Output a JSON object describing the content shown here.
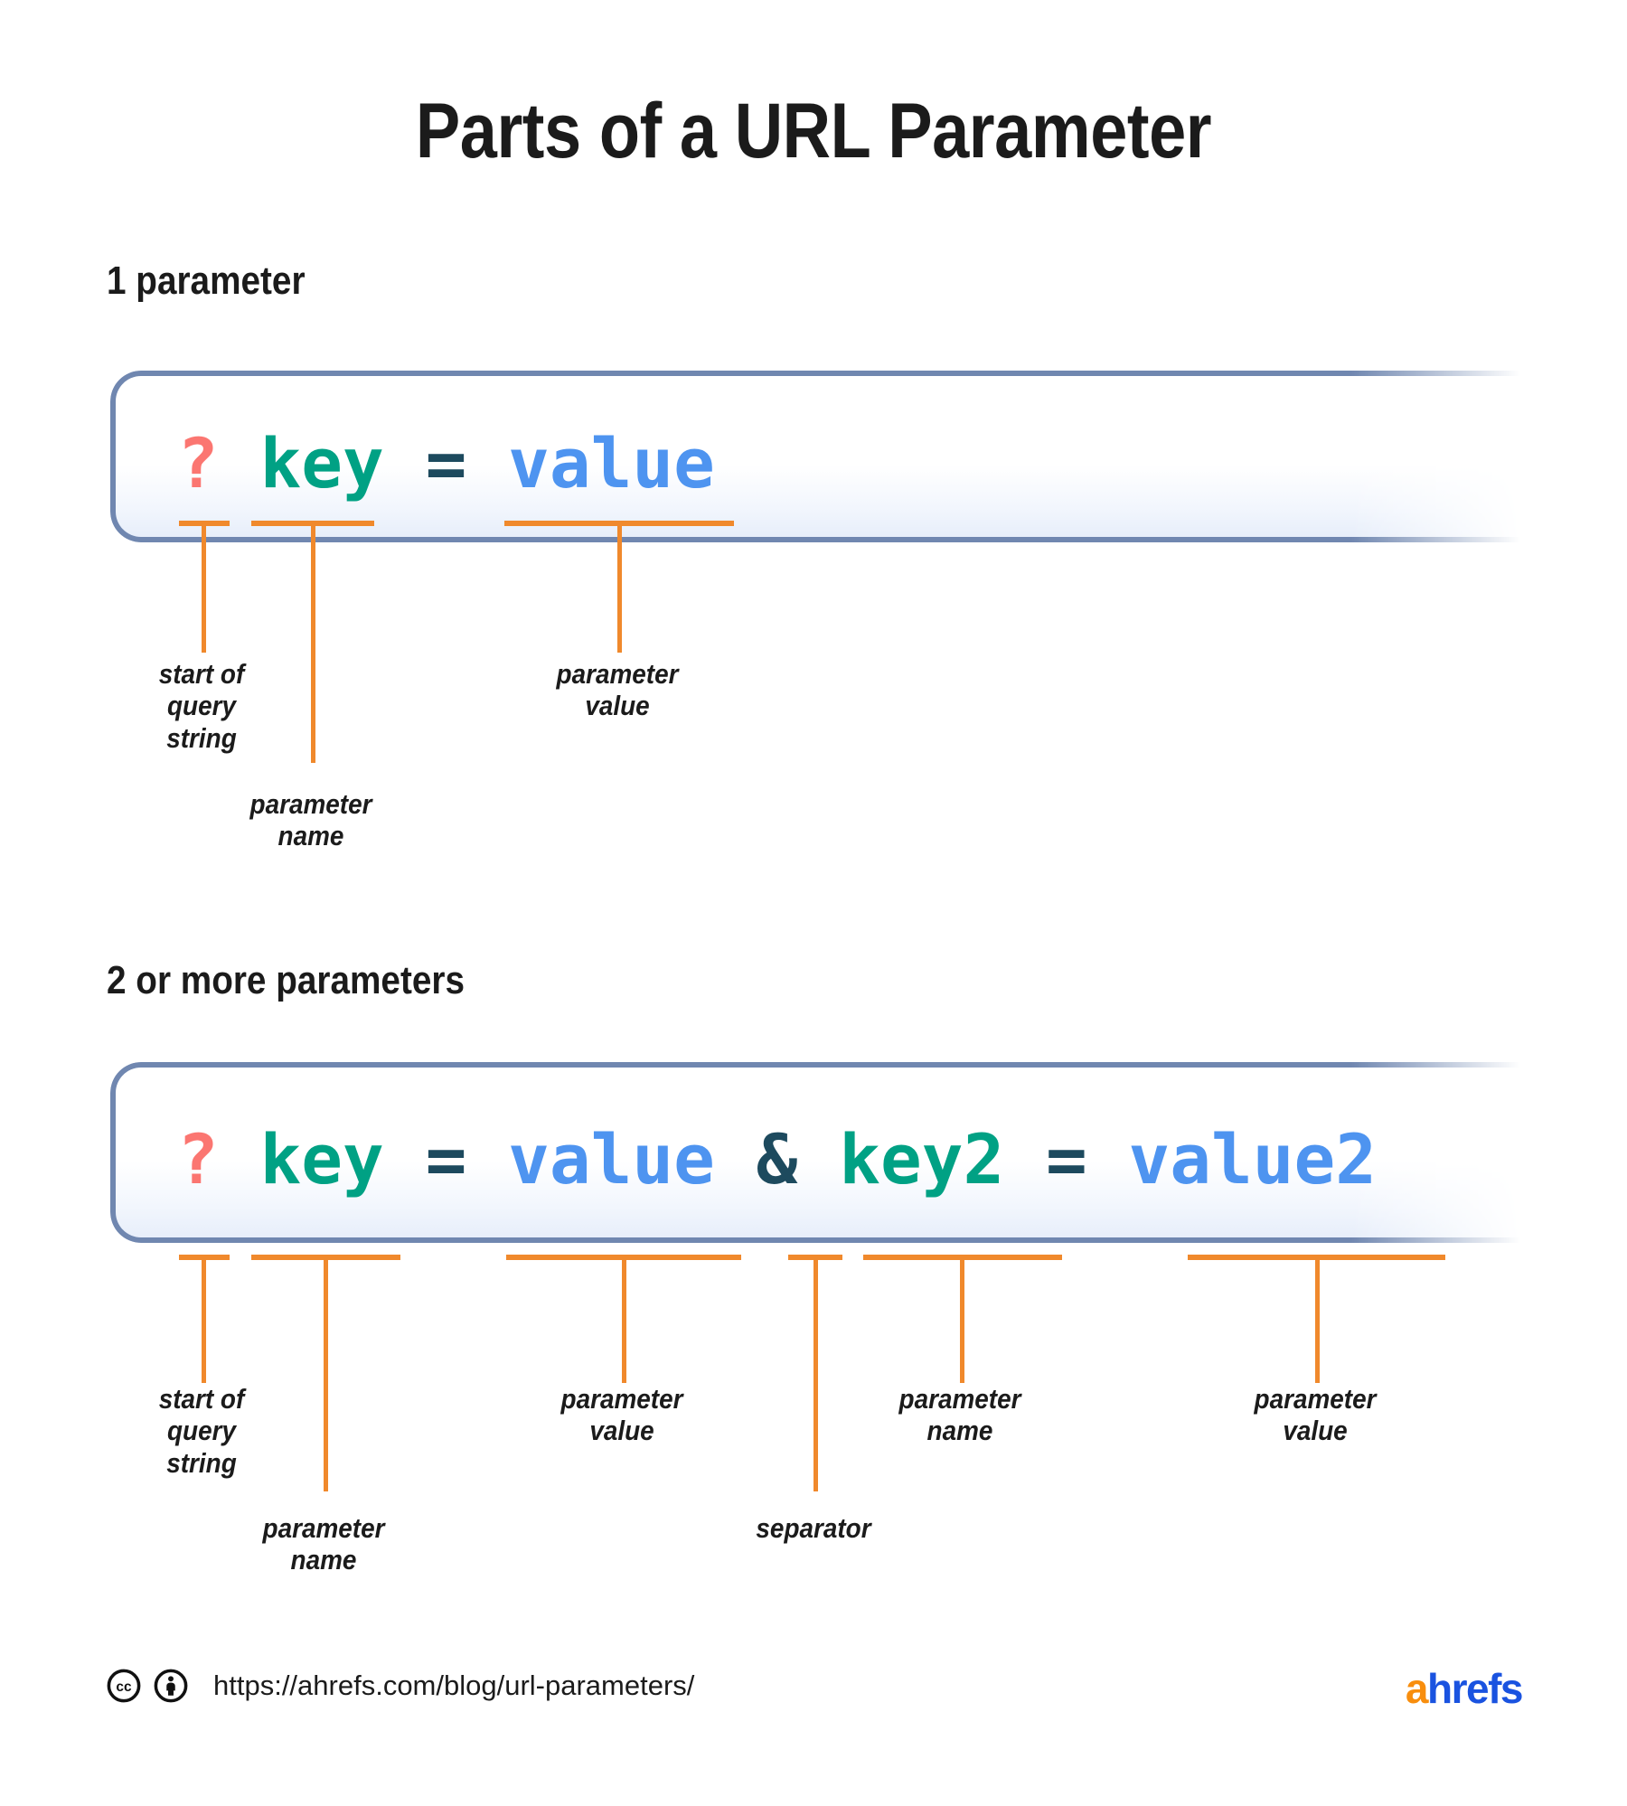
{
  "title": "Parts of a URL Parameter",
  "colors": {
    "query_mark": "#fb7671",
    "param_name": "#00a184",
    "equals": "#1d4a5e",
    "param_value": "#4e94f0",
    "separator": "#1d4a5e",
    "annotation": "#f0892c",
    "box_border": "#7087b0",
    "brand_a": "#f88e0e",
    "brand_rest": "#1a53e0"
  },
  "sections": [
    {
      "heading": "1 parameter",
      "code_tokens": [
        {
          "text": "?",
          "type": "query_mark"
        },
        {
          "text": " ",
          "type": "space"
        },
        {
          "text": "key",
          "type": "param_name"
        },
        {
          "text": " ",
          "type": "space"
        },
        {
          "text": "=",
          "type": "equals"
        },
        {
          "text": " ",
          "type": "space"
        },
        {
          "text": "value",
          "type": "param_value"
        }
      ],
      "annotations": [
        {
          "label": "start of\nquery\nstring"
        },
        {
          "label": "parameter\nname"
        },
        {
          "label": "parameter\nvalue"
        }
      ]
    },
    {
      "heading": "2 or more parameters",
      "code_tokens": [
        {
          "text": "?",
          "type": "query_mark"
        },
        {
          "text": " ",
          "type": "space"
        },
        {
          "text": "key",
          "type": "param_name"
        },
        {
          "text": " ",
          "type": "space"
        },
        {
          "text": "=",
          "type": "equals"
        },
        {
          "text": " ",
          "type": "space"
        },
        {
          "text": "value",
          "type": "param_value"
        },
        {
          "text": " ",
          "type": "space"
        },
        {
          "text": "&",
          "type": "separator"
        },
        {
          "text": " ",
          "type": "space"
        },
        {
          "text": "key2",
          "type": "param_name"
        },
        {
          "text": " ",
          "type": "space"
        },
        {
          "text": "=",
          "type": "equals"
        },
        {
          "text": " ",
          "type": "space"
        },
        {
          "text": "value2",
          "type": "param_value"
        }
      ],
      "annotations": [
        {
          "label": "start of\nquery\nstring"
        },
        {
          "label": "parameter\nname"
        },
        {
          "label": "parameter\nvalue"
        },
        {
          "label": "separator"
        },
        {
          "label": "parameter\nname"
        },
        {
          "label": "parameter\nvalue"
        }
      ]
    }
  ],
  "footer": {
    "license": "CC BY",
    "url": "https://ahrefs.com/blog/url-parameters/",
    "brand_a": "a",
    "brand_rest": "hrefs"
  }
}
